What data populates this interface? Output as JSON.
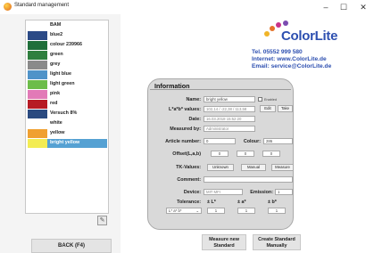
{
  "window": {
    "title": "Standard management",
    "min": "–",
    "max": "☐",
    "close": "✕"
  },
  "sidebar": {
    "items": [
      {
        "label": "BAM",
        "color": "#ffffff"
      },
      {
        "label": "blue2",
        "color": "#2b4a86"
      },
      {
        "label": "colour 239966",
        "color": "#1f6f3a"
      },
      {
        "label": "green",
        "color": "#2f7f3e"
      },
      {
        "label": "grey",
        "color": "#8a8a8a"
      },
      {
        "label": "light blue",
        "color": "#4f93c9"
      },
      {
        "label": "light green",
        "color": "#6cbd4a"
      },
      {
        "label": "pink",
        "color": "#e27ab7"
      },
      {
        "label": "red",
        "color": "#b71b24"
      },
      {
        "label": "Versuch 8%",
        "color": "#2a4a80"
      },
      {
        "label": "white",
        "color": "#ffffff"
      },
      {
        "label": "yellow",
        "color": "#f0a030"
      },
      {
        "label": "bright yellow",
        "color": "#f3ec53",
        "selected": true
      }
    ],
    "trash_icon": "✎",
    "back_label": "BACK (F4)"
  },
  "brand": {
    "name": "ColorLite",
    "tel": "Tel. 05552 999 580",
    "internet": "Internet: www.ColorLite.de",
    "email": "Email: service@ColorLite.de"
  },
  "info": {
    "title": "Information",
    "name_label": "Name:",
    "name_value": "bright yellow",
    "enabled_label": "Enabled",
    "lab_label": "L*a*b* values:",
    "lab_value": "102,14 / -22,38 / 113,58",
    "edit_label": "Edit",
    "take_label": "Take",
    "date_label": "Date:",
    "date_value": "16.03.2018 15:52:20",
    "measured_label": "Measured by:",
    "measured_value": "Administrator",
    "article_label": "Article number:",
    "article_value": "0",
    "colour_label": "Colour:",
    "colour_value": "286",
    "offset_label": "Offset(L,a,b)",
    "offset_values": [
      "0",
      "0",
      "0"
    ],
    "tk_label": "TK-Values:",
    "tk_value": "Unknown",
    "manual_label": "Manual",
    "measure_label": "Measure",
    "comment_label": "Comment:",
    "comment_value": "",
    "device_label": "Device:",
    "device_value": "MIT MFI",
    "emission_label": "Emission:",
    "emission_value": "1",
    "tolerance_label": "Tolerance:",
    "tol_headers": [
      "± L*",
      "± a*",
      "± b*"
    ],
    "tol_mode": "L* a* b*",
    "tol_values": [
      "1",
      "1",
      "1"
    ]
  },
  "actions": {
    "measure_new_line1": "Measure new",
    "measure_new_line2": "Standard",
    "create_line1": "Create Standard",
    "create_line2": "Manually"
  }
}
